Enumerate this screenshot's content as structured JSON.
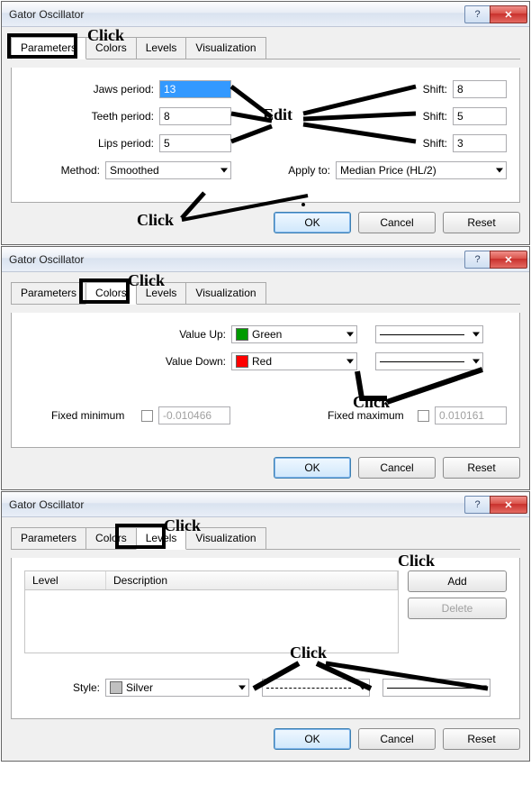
{
  "annotations": {
    "click": "Click",
    "edit": "Edit"
  },
  "dialogs": [
    {
      "title": "Gator Oscillator",
      "tabs": [
        "Parameters",
        "Colors",
        "Levels",
        "Visualization"
      ],
      "active_tab": 0,
      "params": {
        "jaws_label": "Jaws period:",
        "jaws_value": "13",
        "teeth_label": "Teeth period:",
        "teeth_value": "8",
        "lips_label": "Lips period:",
        "lips_value": "5",
        "shift_label": "Shift:",
        "shift1": "8",
        "shift2": "5",
        "shift3": "3",
        "method_label": "Method:",
        "method_value": "Smoothed",
        "apply_label": "Apply to:",
        "apply_value": "Median Price (HL/2)"
      },
      "buttons": {
        "ok": "OK",
        "cancel": "Cancel",
        "reset": "Reset"
      }
    },
    {
      "title": "Gator Oscillator",
      "tabs": [
        "Parameters",
        "Colors",
        "Levels",
        "Visualization"
      ],
      "active_tab": 1,
      "colors": {
        "value_up_label": "Value Up:",
        "value_up_color": "Green",
        "value_up_hex": "#009a00",
        "value_down_label": "Value Down:",
        "value_down_color": "Red",
        "value_down_hex": "#ff0000",
        "fixed_min_label": "Fixed minimum",
        "fixed_min_value": "-0.010466",
        "fixed_max_label": "Fixed maximum",
        "fixed_max_value": "0.010161"
      },
      "buttons": {
        "ok": "OK",
        "cancel": "Cancel",
        "reset": "Reset"
      }
    },
    {
      "title": "Gator Oscillator",
      "tabs": [
        "Parameters",
        "Colors",
        "Levels",
        "Visualization"
      ],
      "active_tab": 2,
      "levels": {
        "col_level": "Level",
        "col_desc": "Description",
        "add": "Add",
        "delete": "Delete",
        "style_label": "Style:",
        "style_value": "Silver",
        "style_hex": "#c0c0c0"
      },
      "buttons": {
        "ok": "OK",
        "cancel": "Cancel",
        "reset": "Reset"
      }
    }
  ]
}
